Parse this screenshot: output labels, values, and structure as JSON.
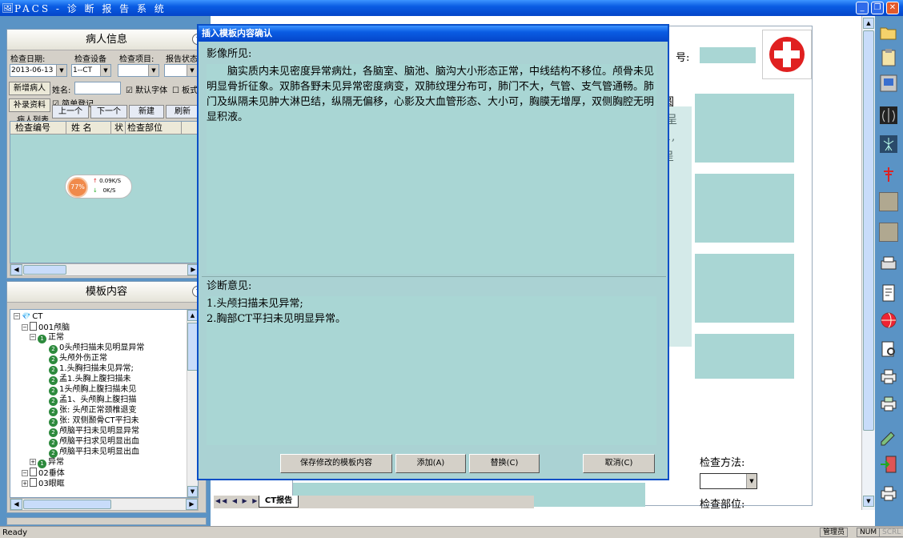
{
  "window": {
    "title": "PACS - 诊 断 报 告 系 统"
  },
  "patient_panel": {
    "title": "病人信息",
    "labels": {
      "exam_date": "检查日期:",
      "exam_device": "检查设备",
      "exam_item": "检查项目:",
      "report_status": "报告状态",
      "name": "姓名:"
    },
    "values": {
      "exam_date": "2013-06-13",
      "exam_device": "1--CT",
      "exam_item": "",
      "report_status": ""
    },
    "buttons": {
      "new_patient": "新增病人",
      "add_record": "补录资料",
      "prev": "上一个",
      "next": "下一个",
      "create": "新建",
      "refresh": "刷新"
    },
    "checks": {
      "default_font": "默认字体",
      "simple_register": "简单登记",
      "template": "板式"
    },
    "list_label": "病人列表",
    "columns": [
      "检查编号",
      "姓 名",
      "状",
      "检查部位",
      ""
    ],
    "net_widget": {
      "percent": "77%",
      "up": "0.09K/S",
      "down": "0K/S"
    }
  },
  "template_panel": {
    "title": "模板内容",
    "tree": [
      {
        "label": "CT",
        "level": 0,
        "icon": "gem"
      },
      {
        "label": "001颅脑",
        "level": 1,
        "icon": "doc"
      },
      {
        "label": "正常",
        "level": 2,
        "icon": "num1"
      },
      {
        "label": "0头颅扫描未见明显异常",
        "level": 3,
        "icon": "num2"
      },
      {
        "label": "头颅外伤正常",
        "level": 3,
        "icon": "num2"
      },
      {
        "label": "1.头胸扫描未见异常;",
        "level": 3,
        "icon": "num2"
      },
      {
        "label": "孟1.头胸上腹扫描未",
        "level": 3,
        "icon": "num2"
      },
      {
        "label": "1头颅胸上腹扫描未见",
        "level": 3,
        "icon": "num2"
      },
      {
        "label": "孟1、头颅胸上腹扫描",
        "level": 3,
        "icon": "num2"
      },
      {
        "label": "张: 头颅正常颈椎退变",
        "level": 3,
        "icon": "num2"
      },
      {
        "label": "张: 双侧颞骨CT平扫未",
        "level": 3,
        "icon": "num2"
      },
      {
        "label": "颅脑平扫未见明显异常",
        "level": 3,
        "icon": "num2"
      },
      {
        "label": "颅脑平扫求见明显出血",
        "level": 3,
        "icon": "num2"
      },
      {
        "label": "颅脑平扫未见明显出血",
        "level": 3,
        "icon": "num2"
      },
      {
        "label": "异常",
        "level": 2,
        "icon": "num1"
      },
      {
        "label": "02垂体",
        "level": 1,
        "icon": "doc"
      },
      {
        "label": "03眼眶",
        "level": 1,
        "icon": "doc"
      }
    ]
  },
  "report": {
    "report_no_label": "号:",
    "partial_lines": [
      "圆",
      "呈",
      "1,",
      "呈"
    ],
    "exam_method_label": "检查方法:",
    "exam_part_label": "检查部位:",
    "tab": "CT报告"
  },
  "modal": {
    "title": "插入模板内容确认",
    "findings_label": "影像所见:",
    "findings_text": "　　脑实质内未见密度异常病灶，各脑室、脑池、脑沟大小形态正常，中线结构不移位。颅骨未见明显骨折征象。双肺各野未见异常密度病变，双肺纹理分布可，肺门不大，气管、支气管通畅。肺门及纵隔未见肿大淋巴结，纵隔无偏移，心影及大血管形态、大小可，胸膜无增厚，双侧胸腔无明显积液。",
    "diagnosis_label": "诊断意见:",
    "diagnosis_lines": [
      "1.头颅扫描未见异常;",
      "2.胸部CT平扫未见明显异常。"
    ],
    "buttons": {
      "save": "保存修改的模板内容",
      "add": "添加(A)",
      "replace": "替换(C)",
      "cancel": "取消(C)"
    }
  },
  "status": {
    "ready": "Ready",
    "user": "管理员",
    "num": "NUM",
    "scrl": "SCRL"
  },
  "colors": {
    "accent_blue": "#0a5ce3",
    "teal_field": "#a9d6d4",
    "pane_blue": "#5a93c5"
  }
}
